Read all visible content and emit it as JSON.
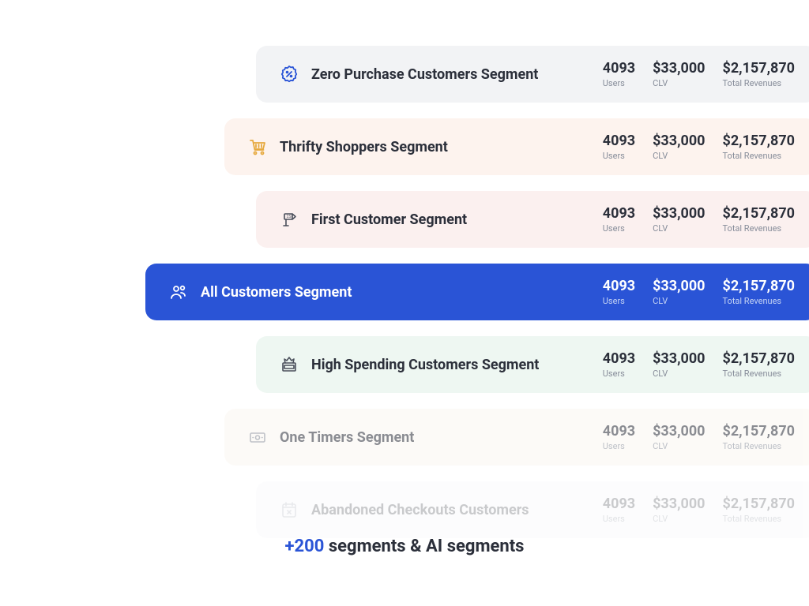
{
  "labels": {
    "users": "Users",
    "clv": "CLV",
    "revenues": "Total Revenues"
  },
  "segments": [
    {
      "title": "Zero Purchase Customers Segment",
      "icon": "percent-badge",
      "users": "4093",
      "clv": "$33,000",
      "revenues": "$2,157,870",
      "variant": "grey"
    },
    {
      "title": "Thrifty Shoppers Segment",
      "icon": "cart",
      "users": "4093",
      "clv": "$33,000",
      "revenues": "$2,157,870",
      "variant": "peach"
    },
    {
      "title": "First Customer Segment",
      "icon": "first-flag",
      "users": "4093",
      "clv": "$33,000",
      "revenues": "$2,157,870",
      "variant": "pink"
    },
    {
      "title": "All Customers Segment",
      "icon": "users",
      "users": "4093",
      "clv": "$33,000",
      "revenues": "$2,157,870",
      "variant": "blue"
    },
    {
      "title": "High Spending Customers Segment",
      "icon": "crown-box",
      "users": "4093",
      "clv": "$33,000",
      "revenues": "$2,157,870",
      "variant": "mint"
    },
    {
      "title": "One Timers Segment",
      "icon": "cash",
      "users": "4093",
      "clv": "$33,000",
      "revenues": "$2,157,870",
      "variant": "cream"
    },
    {
      "title": "Abandoned Checkouts Customers",
      "icon": "calendar-x",
      "users": "4093",
      "clv": "$33,000",
      "revenues": "$2,157,870",
      "variant": "pale"
    }
  ],
  "footer": {
    "accent": "+200",
    "rest": " segments & AI segments"
  }
}
